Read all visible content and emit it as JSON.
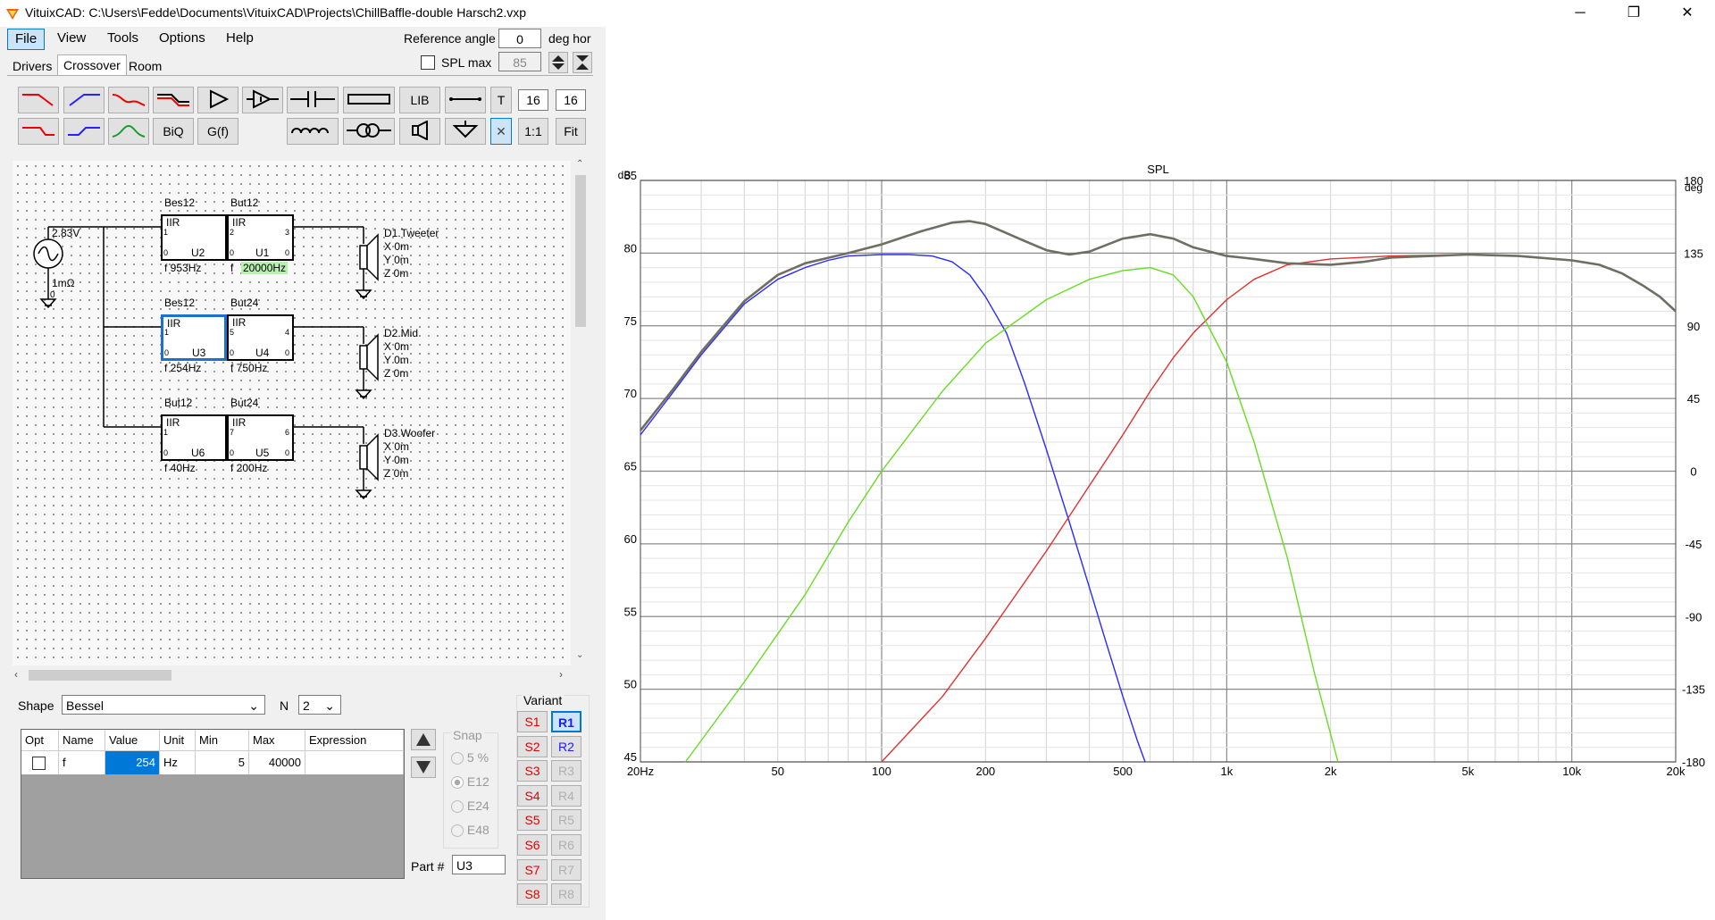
{
  "window": {
    "title": "VituixCAD: C:\\Users\\Fedde\\Documents\\VituixCAD\\Projects\\ChillBaffle-double Harsch2.vxp",
    "minimize": "─",
    "maximize": "❐",
    "close": "✕"
  },
  "menu": {
    "file": "File",
    "view": "View",
    "tools": "Tools",
    "options": "Options",
    "help": "Help"
  },
  "header": {
    "reference_angle_label": "Reference angle",
    "reference_angle_value": "0",
    "reference_angle_unit": "deg hor",
    "spl_max_label": "SPL max",
    "spl_max_value": "85"
  },
  "tabs": {
    "drivers": "Drivers",
    "crossover": "Crossover",
    "room": "Room"
  },
  "toolbar": {
    "lib": "LIB",
    "t": "T",
    "biq": "BiQ",
    "gf": "G(f)",
    "one_one": "1:1",
    "fit": "Fit",
    "grid_x": "16",
    "grid_y": "16"
  },
  "schematic": {
    "source_voltage": "2.83V",
    "source_impedance": "1mΩ",
    "source_node": "0",
    "blocks": [
      {
        "type": "Bes12",
        "kind": "IIR",
        "name": "U2",
        "freq": "f  953Hz",
        "in_node": "1",
        "out_node": "2"
      },
      {
        "type": "But12",
        "kind": "IIR",
        "name": "U1",
        "freq": "20000Hz",
        "freq_prefix": "f ",
        "in_node": "2",
        "out_node": "3"
      },
      {
        "type": "Bes12",
        "kind": "IIR",
        "name": "U3",
        "freq": "f  254Hz",
        "in_node": "1",
        "out_node": "5"
      },
      {
        "type": "But24",
        "kind": "IIR",
        "name": "U4",
        "freq": "f  750Hz",
        "in_node": "5",
        "out_node": "4"
      },
      {
        "type": "But12",
        "kind": "IIR",
        "name": "U6",
        "freq": "f  40Hz",
        "in_node": "1",
        "out_node": "7"
      },
      {
        "type": "But24",
        "kind": "IIR",
        "name": "U5",
        "freq": "f  200Hz",
        "in_node": "7",
        "out_node": "6"
      }
    ],
    "drivers": [
      {
        "name": "D1.Tweeter",
        "x": "X 0m",
        "y": "Y 0m",
        "z": "Z 0m"
      },
      {
        "name": "D2.Mid",
        "x": "X 0m",
        "y": "Y 0m",
        "z": "Z 0m"
      },
      {
        "name": "D3.Woofer",
        "x": "X 0m",
        "y": "Y 0m",
        "z": "Z 0m"
      }
    ]
  },
  "properties": {
    "shape_label": "Shape",
    "shape_value": "Bessel",
    "n_label": "N",
    "n_value": "2",
    "columns": [
      "Opt",
      "Name",
      "Value",
      "Unit",
      "Min",
      "Max",
      "Expression"
    ],
    "row": {
      "name": "f",
      "value": "254",
      "unit": "Hz",
      "min": "5",
      "max": "40000",
      "expression": ""
    },
    "snap_label": "Snap",
    "snap_options": [
      "5 %",
      "E12",
      "E24",
      "E48"
    ],
    "part_label": "Part #",
    "part_value": "U3"
  },
  "variant": {
    "label": "Variant",
    "s": [
      "S1",
      "S2",
      "S3",
      "S4",
      "S5",
      "S6",
      "S7",
      "S8"
    ],
    "r": [
      "R1",
      "R2",
      "R3",
      "R4",
      "R5",
      "R6",
      "R7",
      "R8"
    ],
    "active_r": "R1"
  },
  "chart_data": {
    "type": "line",
    "title": "SPL",
    "ylabel": "dB",
    "y2label": "deg",
    "xscale": "log",
    "xlim": [
      20,
      20000
    ],
    "ylim": [
      45,
      85
    ],
    "y2lim": [
      -180,
      180
    ],
    "grid": true,
    "x_ticks": [
      {
        "v": 20,
        "label": "20Hz"
      },
      {
        "v": 50,
        "label": "50"
      },
      {
        "v": 100,
        "label": "100"
      },
      {
        "v": 200,
        "label": "200"
      },
      {
        "v": 500,
        "label": "500"
      },
      {
        "v": 1000,
        "label": "1k"
      },
      {
        "v": 2000,
        "label": "2k"
      },
      {
        "v": 5000,
        "label": "5k"
      },
      {
        "v": 10000,
        "label": "10k"
      },
      {
        "v": 20000,
        "label": "20k"
      }
    ],
    "y_ticks": [
      {
        "v": 85,
        "label": "85"
      },
      {
        "v": 80,
        "label": "80"
      },
      {
        "v": 75,
        "label": "75"
      },
      {
        "v": 70,
        "label": "70"
      },
      {
        "v": 65,
        "label": "65"
      },
      {
        "v": 60,
        "label": "60"
      },
      {
        "v": 55,
        "label": "55"
      },
      {
        "v": 50,
        "label": "50"
      },
      {
        "v": 45,
        "label": "45"
      }
    ],
    "y2_ticks": [
      {
        "v": 180,
        "label": "180"
      },
      {
        "v": 135,
        "label": "135"
      },
      {
        "v": 90,
        "label": "90"
      },
      {
        "v": 45,
        "label": "45"
      },
      {
        "v": 0,
        "label": "0"
      },
      {
        "v": -45,
        "label": "-45"
      },
      {
        "v": -90,
        "label": "-90"
      },
      {
        "v": -135,
        "label": "-135"
      },
      {
        "v": -180,
        "label": "-180"
      }
    ],
    "series": [
      {
        "color": "#2a2aff",
        "points": [
          [
            20,
            67.5
          ],
          [
            25,
            70.5
          ],
          [
            30,
            73
          ],
          [
            40,
            76.5
          ],
          [
            50,
            78.2
          ],
          [
            60,
            79
          ],
          [
            70,
            79.5
          ],
          [
            80,
            79.8
          ],
          [
            100,
            79.9
          ],
          [
            120,
            79.9
          ],
          [
            140,
            79.8
          ],
          [
            160,
            79.4
          ],
          [
            180,
            78.5
          ],
          [
            200,
            77
          ],
          [
            230,
            74.5
          ],
          [
            260,
            71
          ],
          [
            300,
            66.5
          ],
          [
            350,
            61.5
          ],
          [
            400,
            57
          ],
          [
            450,
            53
          ],
          [
            500,
            49.5
          ],
          [
            550,
            46.5
          ],
          [
            580,
            45
          ]
        ]
      },
      {
        "color": "#e03030",
        "points": [
          [
            100,
            45
          ],
          [
            150,
            49.5
          ],
          [
            200,
            53.5
          ],
          [
            300,
            59.5
          ],
          [
            400,
            64
          ],
          [
            500,
            67.5
          ],
          [
            600,
            70.5
          ],
          [
            700,
            72.8
          ],
          [
            800,
            74.5
          ],
          [
            1000,
            76.8
          ],
          [
            1200,
            78.2
          ],
          [
            1500,
            79.2
          ],
          [
            2000,
            79.6
          ],
          [
            3000,
            79.8
          ],
          [
            5000,
            79.9
          ],
          [
            7000,
            79.8
          ],
          [
            10000,
            79.5
          ],
          [
            12000,
            79.2
          ],
          [
            14000,
            78.6
          ],
          [
            16000,
            77.8
          ],
          [
            18000,
            77
          ],
          [
            20000,
            76
          ]
        ]
      },
      {
        "color": "#66dd22",
        "points": [
          [
            27,
            45
          ],
          [
            40,
            50.5
          ],
          [
            60,
            56.5
          ],
          [
            80,
            61.5
          ],
          [
            100,
            65
          ],
          [
            150,
            70.5
          ],
          [
            200,
            73.8
          ],
          [
            300,
            76.8
          ],
          [
            400,
            78.2
          ],
          [
            500,
            78.8
          ],
          [
            600,
            79
          ],
          [
            700,
            78.5
          ],
          [
            800,
            77
          ],
          [
            1000,
            72.5
          ],
          [
            1200,
            67
          ],
          [
            1500,
            59
          ],
          [
            1800,
            51
          ],
          [
            2100,
            45
          ]
        ]
      },
      {
        "color": "#6e6e63",
        "points": [
          [
            20,
            67.8
          ],
          [
            25,
            70.7
          ],
          [
            30,
            73.2
          ],
          [
            40,
            76.7
          ],
          [
            50,
            78.5
          ],
          [
            60,
            79.3
          ],
          [
            80,
            80
          ],
          [
            100,
            80.6
          ],
          [
            130,
            81.5
          ],
          [
            160,
            82.1
          ],
          [
            180,
            82.2
          ],
          [
            200,
            82
          ],
          [
            250,
            81
          ],
          [
            300,
            80.2
          ],
          [
            350,
            79.9
          ],
          [
            400,
            80.1
          ],
          [
            500,
            81
          ],
          [
            600,
            81.3
          ],
          [
            700,
            81
          ],
          [
            800,
            80.4
          ],
          [
            1000,
            79.8
          ],
          [
            1200,
            79.6
          ],
          [
            1500,
            79.3
          ],
          [
            2000,
            79.2
          ],
          [
            2500,
            79.4
          ],
          [
            3000,
            79.7
          ],
          [
            5000,
            79.9
          ],
          [
            7000,
            79.8
          ],
          [
            10000,
            79.5
          ],
          [
            12000,
            79.2
          ],
          [
            14000,
            78.6
          ],
          [
            16000,
            77.8
          ],
          [
            18000,
            77
          ],
          [
            20000,
            76
          ]
        ]
      }
    ]
  }
}
